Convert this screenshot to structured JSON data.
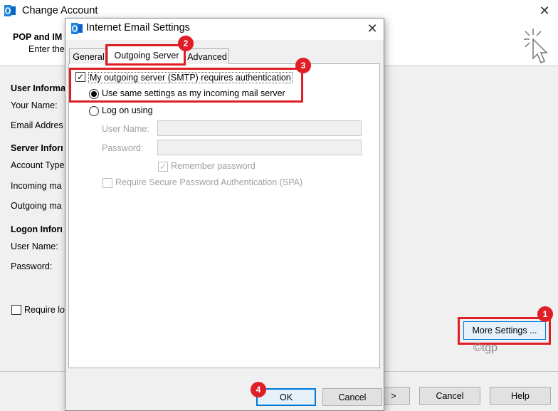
{
  "background_window": {
    "title": "Change Account",
    "close_glyph": "✕",
    "header_title": "POP and IM",
    "header_subtitle": "Enter the",
    "sections": {
      "user_info": "User Informa",
      "server_info": "Server Inforı",
      "logon_info": "Logon Inforı"
    },
    "labels": {
      "your_name": "Your Name:",
      "email_address": "Email Addres",
      "account_type": "Account Type",
      "incoming_mail": "Incoming ma",
      "outgoing_mail": "Outgoing ma",
      "user_name": "User Name:",
      "password": "Password:",
      "require_logon": "Require lo"
    },
    "more_settings_label": "More Settings ...",
    "buttons": {
      "next": ">",
      "cancel": "Cancel",
      "help": "Help"
    }
  },
  "dialog": {
    "title": "Internet Email Settings",
    "close_glyph": "✕",
    "tabs": [
      "General",
      "Outgoing Server",
      "Advanced"
    ],
    "active_tab": "Outgoing Server",
    "smtp_auth": {
      "label": "My outgoing server (SMTP) requires authentication",
      "checked": true
    },
    "options": {
      "use_same": "Use same settings as my incoming mail server",
      "log_on_using": "Log on using",
      "selected": "use_same"
    },
    "fields": {
      "user_name_label": "User Name:",
      "user_name_value": "",
      "password_label": "Password:",
      "password_value": ""
    },
    "remember_password": {
      "label": "Remember password",
      "checked": true
    },
    "spa": {
      "label": "Require Secure Password Authentication (SPA)",
      "checked": false
    },
    "buttons": {
      "ok": "OK",
      "cancel": "Cancel"
    }
  },
  "annotations": {
    "badges": [
      "1",
      "2",
      "3",
      "4"
    ],
    "highlight_color": "#e01e25",
    "watermark": "©tgp"
  },
  "colors": {
    "accent_blue": "#0078d7",
    "window_bg": "#f0f0f0"
  }
}
